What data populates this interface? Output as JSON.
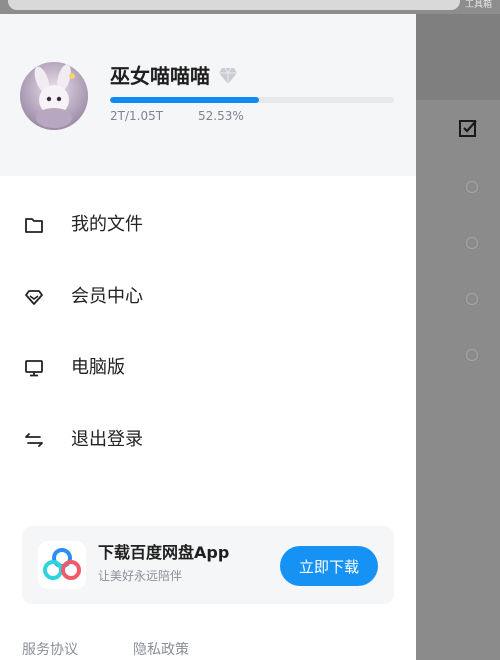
{
  "background": {
    "toolbox_label": "工具箱"
  },
  "profile": {
    "username": "巫女喵喵喵",
    "storage_text": "2T/1.05T",
    "storage_percent_text": "52.53%",
    "storage_fraction": 0.5253
  },
  "menu": {
    "items": [
      {
        "label": "我的文件",
        "icon": "folder-icon"
      },
      {
        "label": "会员中心",
        "icon": "diamond-icon"
      },
      {
        "label": "电脑版",
        "icon": "monitor-icon"
      },
      {
        "label": "退出登录",
        "icon": "swap-arrows-icon"
      }
    ]
  },
  "promo": {
    "title": "下载百度网盘App",
    "subtitle": "让美好永远陪伴",
    "button_label": "立即下载"
  },
  "footer": {
    "terms": "服务协议",
    "privacy": "隐私政策"
  },
  "colors": {
    "accent": "#1692f5",
    "progress": "#0f8cf2",
    "overlay": "#8b8b8b"
  }
}
